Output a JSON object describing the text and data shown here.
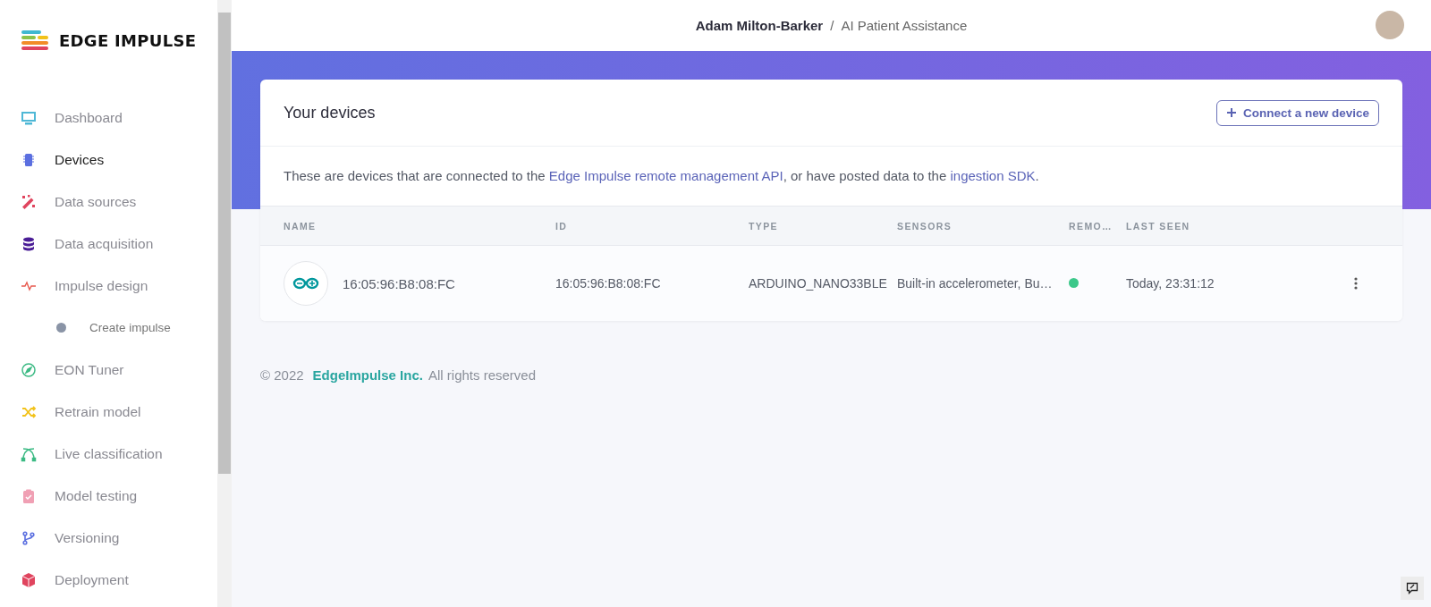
{
  "logo": {
    "text": "EDGE IMPULSE"
  },
  "sidebar": {
    "items": [
      {
        "label": "Dashboard",
        "selected": false,
        "color": "#4fb8d6"
      },
      {
        "label": "Devices",
        "selected": true,
        "color": "#5b6fe0"
      },
      {
        "label": "Data sources",
        "selected": false,
        "color": "#e0445e"
      },
      {
        "label": "Data acquisition",
        "selected": false,
        "color": "#4a1d96"
      },
      {
        "label": "Impulse design",
        "selected": false,
        "color": "#e85a4f",
        "children": [
          {
            "label": "Create impulse",
            "selected": false,
            "color": "#8a94a6"
          }
        ]
      },
      {
        "label": "EON Tuner",
        "selected": false,
        "color": "#3cba84"
      },
      {
        "label": "Retrain model",
        "selected": false,
        "color": "#f2c21a"
      },
      {
        "label": "Live classification",
        "selected": false,
        "color": "#3cba84"
      },
      {
        "label": "Model testing",
        "selected": false,
        "color": "#f0a0b4"
      },
      {
        "label": "Versioning",
        "selected": false,
        "color": "#5b6fe0"
      },
      {
        "label": "Deployment",
        "selected": false,
        "color": "#e0445e"
      }
    ]
  },
  "header": {
    "user": "Adam Milton-Barker",
    "separator": "/",
    "project": "AI Patient Assistance"
  },
  "card": {
    "title": "Your devices",
    "button": "Connect a new device",
    "description": [
      {
        "kind": "text",
        "text": "These are devices that are connected to the "
      },
      {
        "kind": "link",
        "text": "Edge Impulse remote management API"
      },
      {
        "kind": "text",
        "text": ", or have posted data to the "
      },
      {
        "kind": "link",
        "text": "ingestion SDK"
      },
      {
        "kind": "text",
        "text": "."
      }
    ],
    "columns": [
      "NAME",
      "ID",
      "TYPE",
      "SENSORS",
      "REMO…",
      "LAST SEEN"
    ],
    "rows": [
      {
        "name": "16:05:96:B8:08:FC",
        "id": "16:05:96:B8:08:FC",
        "type": "ARDUINO_NANO33BLE",
        "sensors": "Built-in accelerometer, Bu…",
        "remote_connected": true,
        "last_seen": "Today, 23:31:12"
      }
    ]
  },
  "footer": {
    "copyright": "© 2022",
    "company": "EdgeImpulse Inc.",
    "rights": "All rights reserved"
  }
}
